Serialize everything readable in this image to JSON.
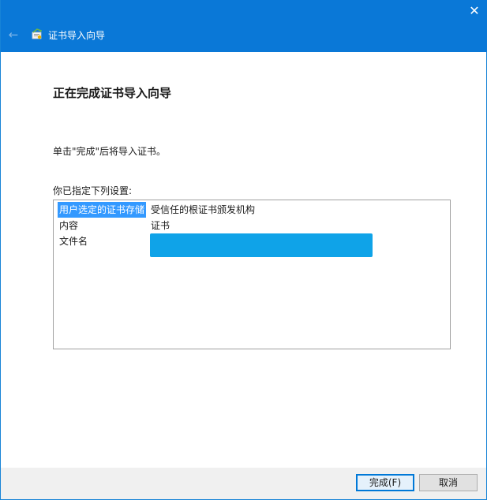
{
  "window": {
    "title": "证书导入向导",
    "close_glyph": "✕",
    "back_glyph": "←"
  },
  "wizard": {
    "heading": "正在完成证书导入向导",
    "instruction": "单击\"完成\"后将导入证书。",
    "settings_label": "你已指定下列设置:",
    "settings": [
      {
        "key": "用户选定的证书存储",
        "value": "受信任的根证书颁发机构",
        "selected": true
      },
      {
        "key": "内容",
        "value": "证书",
        "selected": false
      },
      {
        "key": "文件名",
        "value": "",
        "selected": false
      }
    ]
  },
  "buttons": {
    "finish_label": "完成(F)",
    "cancel_label": "取消"
  },
  "colors": {
    "titlebar": "#0a78d7",
    "selection": "#3399ff",
    "redaction": "#0fa3e8"
  },
  "icons": {
    "back": "back-arrow-icon",
    "app": "certificate-wizard-icon",
    "close": "close-icon"
  }
}
